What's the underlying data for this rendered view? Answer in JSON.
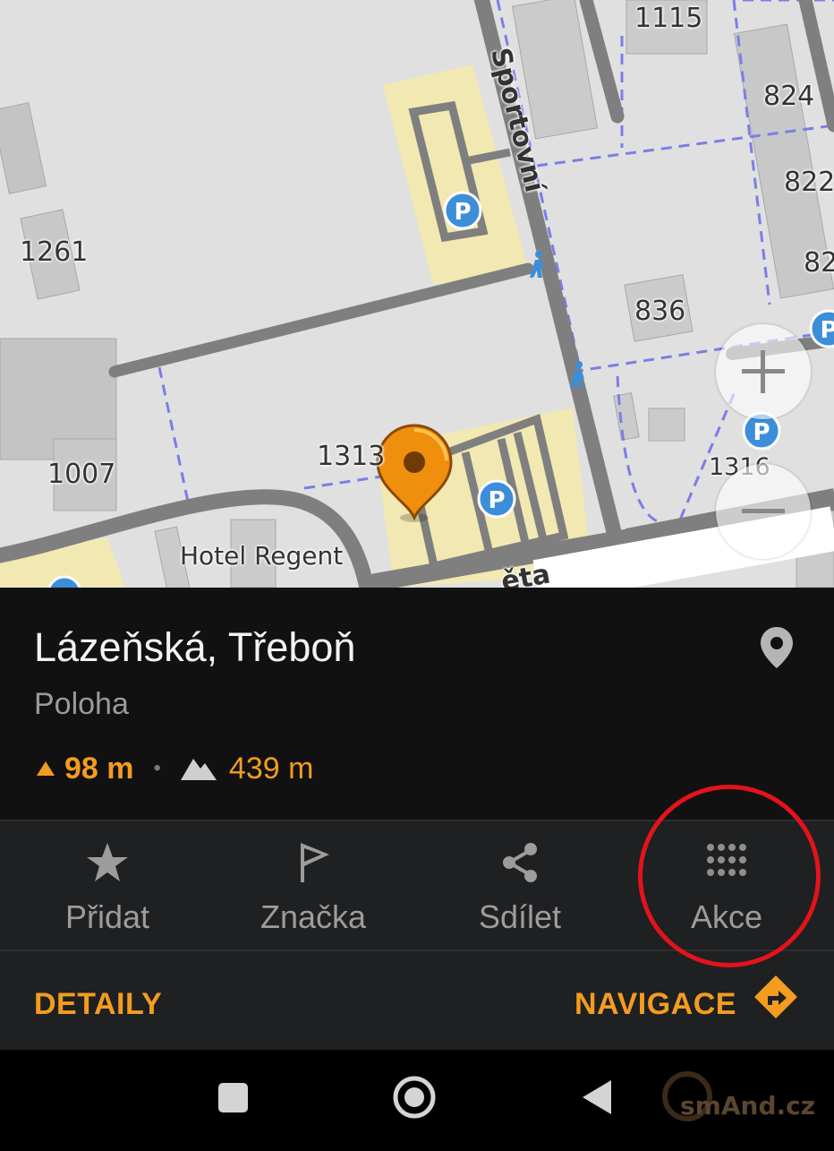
{
  "map": {
    "labels": {
      "sportovni": "Sportovní",
      "n1115": "1115",
      "n824": "824",
      "n822": "822",
      "n82": "82",
      "n1261": "1261",
      "n836": "836",
      "n1313": "1313",
      "n1007": "1007",
      "n1316": "1316",
      "hotel": "Hotel Regent",
      "street_partial": "ěta"
    },
    "parking_glyph": "P"
  },
  "place": {
    "title": "Lázeňská, Třeboň",
    "type": "Poloha",
    "distance": "98 m",
    "separator": "•",
    "altitude": "439 m"
  },
  "actions": [
    {
      "label": "Přidat",
      "icon": "star-icon"
    },
    {
      "label": "Značka",
      "icon": "flag-icon"
    },
    {
      "label": "Sdílet",
      "icon": "share-icon"
    },
    {
      "label": "Akce",
      "icon": "grid-dots-icon"
    }
  ],
  "footer": {
    "details_label": "DETAILY",
    "navigate_label": "NAVIGACE"
  },
  "watermark": "smAnd.cz",
  "colors": {
    "accent": "#f39c20",
    "highlight_circle": "#e3131b",
    "panel_bg": "#111112",
    "bar_bg": "#1f2022"
  }
}
